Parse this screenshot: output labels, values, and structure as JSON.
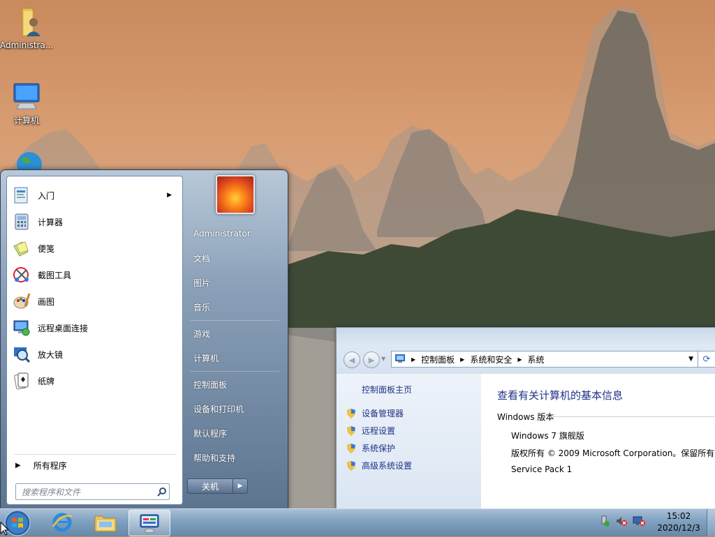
{
  "desktop": {
    "icons": [
      {
        "label": "Administra...",
        "icon": "user-folder-icon"
      },
      {
        "label": "计算机",
        "icon": "computer-icon"
      },
      {
        "label": "",
        "icon": "network-globe-icon"
      }
    ]
  },
  "start_menu": {
    "programs": [
      {
        "label": "入门",
        "icon": "getting-started-icon",
        "has_submenu": true
      },
      {
        "label": "计算器",
        "icon": "calculator-icon"
      },
      {
        "label": "便笺",
        "icon": "sticky-notes-icon"
      },
      {
        "label": "截图工具",
        "icon": "snipping-tool-icon"
      },
      {
        "label": "画图",
        "icon": "paint-icon"
      },
      {
        "label": "远程桌面连接",
        "icon": "remote-desktop-icon"
      },
      {
        "label": "放大镜",
        "icon": "magnifier-icon"
      },
      {
        "label": "纸牌",
        "icon": "solitaire-icon"
      }
    ],
    "all_programs": "所有程序",
    "search_placeholder": "搜索程序和文件",
    "right": {
      "user": "Administrator",
      "items": [
        "文档",
        "图片",
        "音乐",
        "游戏",
        "计算机",
        "控制面板",
        "设备和打印机",
        "默认程序",
        "帮助和支持"
      ]
    },
    "shutdown_label": "关机"
  },
  "control_panel": {
    "breadcrumb": [
      "控制面板",
      "系统和安全",
      "系统"
    ],
    "left": {
      "home": "控制面板主页",
      "links": [
        "设备管理器",
        "远程设置",
        "系统保护",
        "高级系统设置"
      ]
    },
    "main": {
      "title": "查看有关计算机的基本信息",
      "section": "Windows 版本",
      "edition": "Windows 7 旗舰版",
      "copyright": "版权所有 © 2009 Microsoft Corporation。保留所有",
      "service_pack": "Service Pack 1"
    }
  },
  "taskbar": {
    "time": "15:02",
    "date": "2020/12/3",
    "pinned": [
      "internet-explorer-icon",
      "windows-explorer-icon",
      "control-panel-icon"
    ]
  },
  "colors": {
    "link": "#1e3287",
    "taskbar": "#7fa0bf",
    "start_menu_frame": "#5d748f"
  }
}
